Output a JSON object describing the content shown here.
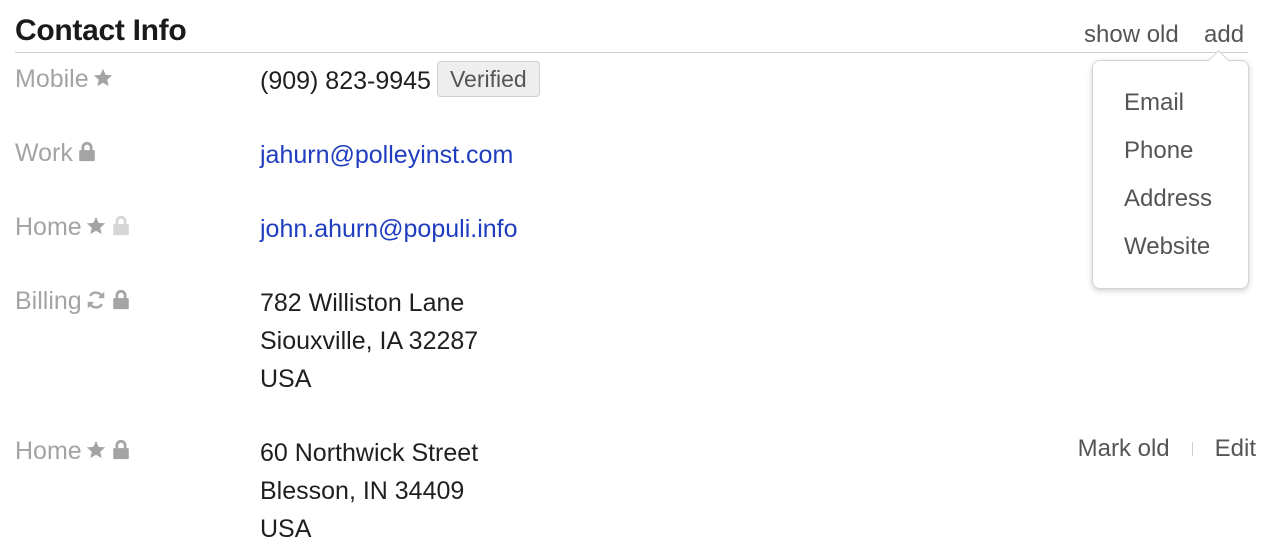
{
  "header": {
    "title": "Contact Info",
    "show_old": "show old",
    "add": "add"
  },
  "add_menu": {
    "items": [
      "Email",
      "Phone",
      "Address",
      "Website"
    ]
  },
  "contacts": [
    {
      "label": "Mobile",
      "value": "(909) 823-9945",
      "badge": "Verified",
      "icons": [
        "star-icon"
      ]
    },
    {
      "label": "Work",
      "value": "jahurn@polleyinst.com",
      "icons": [
        "lock-icon"
      ]
    },
    {
      "label": "Home",
      "value": "john.ahurn@populi.info",
      "icons": [
        "star-icon",
        "lock-icon"
      ]
    },
    {
      "label": "Billing",
      "lines": [
        "782 Williston Lane",
        "Siouxville, IA 32287",
        "USA"
      ],
      "icons": [
        "sync-icon",
        "lock-icon"
      ]
    },
    {
      "label": "Home",
      "lines": [
        "60 Northwick Street",
        "Blesson, IN 34409",
        "USA"
      ],
      "icons": [
        "star-icon",
        "lock-icon"
      ],
      "actions": {
        "mark_old": "Mark old",
        "edit": "Edit"
      }
    }
  ],
  "colors": {
    "label": "#a4a4a4",
    "link": "#1f3dbf",
    "text": "#1f1f1f",
    "muted_action": "#555555"
  }
}
